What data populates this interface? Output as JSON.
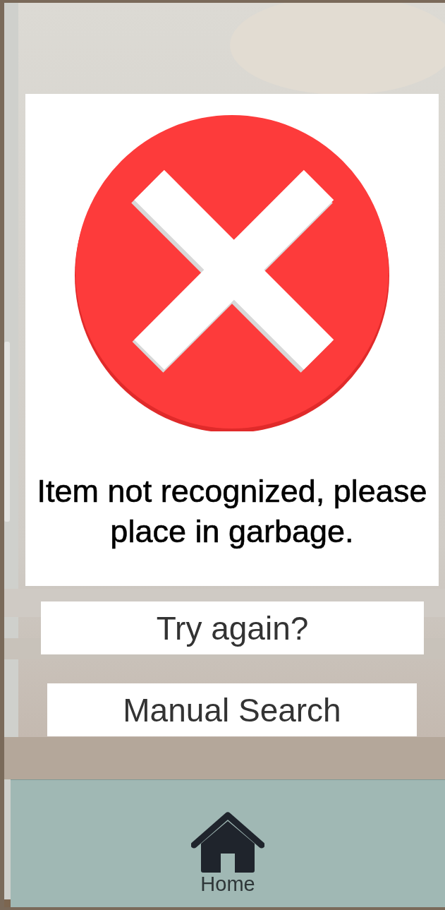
{
  "result": {
    "kind": "error",
    "message": "Item not recognized, please place in garbage."
  },
  "buttons": [
    {
      "label": "Try again?"
    },
    {
      "label": "Manual Search"
    }
  ],
  "nav": [
    {
      "label": "Home",
      "kind": "home"
    }
  ]
}
